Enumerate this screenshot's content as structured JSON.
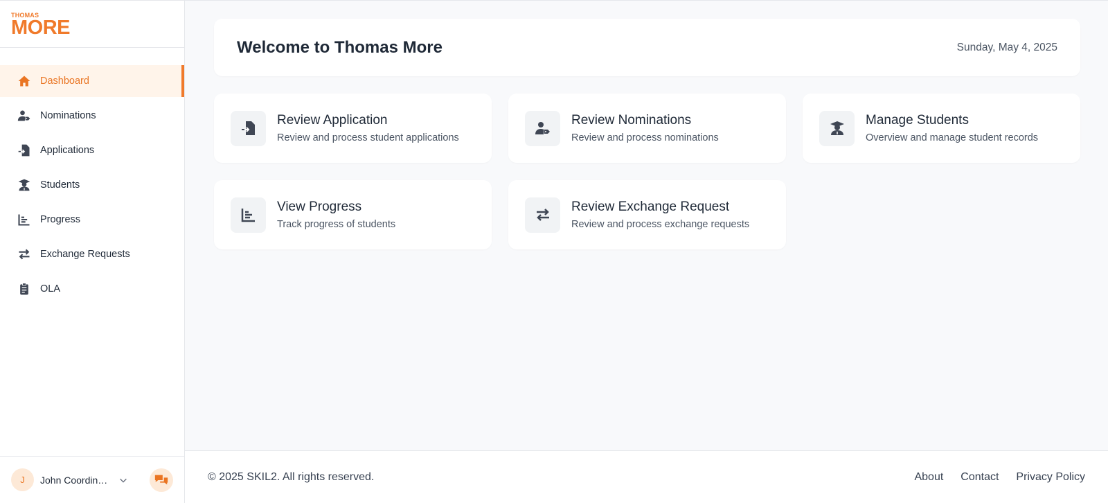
{
  "brand": {
    "small": "THOMAS",
    "big": "MORE",
    "color": "#f07a2b"
  },
  "sidebar": {
    "items": [
      {
        "label": "Dashboard",
        "icon": "home-icon",
        "active": true
      },
      {
        "label": "Nominations",
        "icon": "user-tag-icon"
      },
      {
        "label": "Applications",
        "icon": "file-import-icon"
      },
      {
        "label": "Students",
        "icon": "graduate-icon"
      },
      {
        "label": "Progress",
        "icon": "bar-chart-icon"
      },
      {
        "label": "Exchange Requests",
        "icon": "exchange-arrows-icon"
      },
      {
        "label": "OLA",
        "icon": "clipboard-icon"
      }
    ]
  },
  "user": {
    "initial": "J",
    "name": "John Coordinator"
  },
  "header": {
    "title": "Welcome to Thomas More",
    "date": "Sunday, May 4, 2025"
  },
  "cards": [
    {
      "title": "Review Application",
      "desc": "Review and process student applications",
      "icon": "file-import-icon"
    },
    {
      "title": "Review Nominations",
      "desc": "Review and process nominations",
      "icon": "user-tag-icon"
    },
    {
      "title": "Manage Students",
      "desc": "Overview and manage student records",
      "icon": "graduate-icon"
    },
    {
      "title": "View Progress",
      "desc": "Track progress of students",
      "icon": "bar-chart-icon"
    },
    {
      "title": "Review Exchange Request",
      "desc": "Review and process exchange requests",
      "icon": "exchange-arrows-icon"
    }
  ],
  "footer": {
    "copyright": "© 2025 SKIL2. All rights reserved.",
    "links": [
      "About",
      "Contact",
      "Privacy Policy"
    ]
  },
  "colors": {
    "accent": "#f07a2b",
    "active_bg": "#fff4ea",
    "icon_gray": "#3f4654"
  }
}
